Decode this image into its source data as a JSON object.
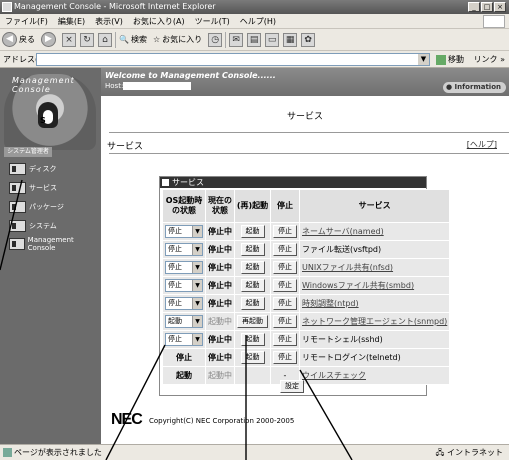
{
  "window": {
    "title": "Management Console - Microsoft Internet Explorer"
  },
  "menu": [
    "ファイル(F)",
    "編集(E)",
    "表示(V)",
    "お気に入り(A)",
    "ツール(T)",
    "ヘルプ(H)"
  ],
  "toolbar": {
    "back": "戻る",
    "search": "検索",
    "favorites": "お気に入り"
  },
  "address": {
    "label": "アドレス(D)",
    "value": "",
    "go": "移動",
    "links": "リンク »"
  },
  "sidebar": {
    "logo_text": "Management Console",
    "logo_letter": "S",
    "section_label": "システム管理者",
    "items": [
      {
        "label": "ディスク"
      },
      {
        "label": "サービス"
      },
      {
        "label": "パッケージ"
      },
      {
        "label": "システム"
      },
      {
        "label": "Management Console"
      }
    ]
  },
  "banner": {
    "welcome": "Welcome to Management Console......",
    "host_label": "Host:",
    "info": "Information"
  },
  "page": {
    "title": "サービス",
    "breadcrumb": "サービス",
    "help": "[ヘルプ]"
  },
  "services": {
    "header": "サービス",
    "columns": [
      "OS起動時の状態",
      "現在の状態",
      "(再)起動",
      "停止",
      "サービス"
    ],
    "rows": [
      {
        "boot": "停止",
        "state": "停止中",
        "start": "起動",
        "stop": "停止",
        "name": "ネームサーバ(named)",
        "link": true,
        "grey": false
      },
      {
        "boot": "停止",
        "state": "停止中",
        "start": "起動",
        "stop": "停止",
        "name": "ファイル転送(vsftpd)",
        "link": false,
        "grey": false
      },
      {
        "boot": "停止",
        "state": "停止中",
        "start": "起動",
        "stop": "停止",
        "name": "UNIXファイル共有(nfsd)",
        "link": true,
        "grey": false
      },
      {
        "boot": "停止",
        "state": "停止中",
        "start": "起動",
        "stop": "停止",
        "name": "Windowsファイル共有(smbd)",
        "link": true,
        "grey": false
      },
      {
        "boot": "停止",
        "state": "停止中",
        "start": "起動",
        "stop": "停止",
        "name": "時刻調整(ntpd)",
        "link": true,
        "grey": false
      },
      {
        "boot": "起動",
        "state": "起動中",
        "start": "再起動",
        "stop": "停止",
        "name": "ネットワーク管理エージェント(snmpd)",
        "link": true,
        "grey": true
      },
      {
        "boot": "停止",
        "state": "停止中",
        "start": "起動",
        "stop": "停止",
        "name": "リモートシェル(sshd)",
        "link": false,
        "grey": false
      },
      {
        "boot": "停止",
        "state": "停止中",
        "start": "起動",
        "stop": "停止",
        "name": "リモートログイン(telnetd)",
        "link": false,
        "grey": false,
        "fixed_boot": true
      },
      {
        "boot": "起動",
        "state": "起動中",
        "start": "",
        "stop": "-",
        "name": "ウイルスチェック",
        "link": true,
        "grey": true,
        "fixed_boot": true
      }
    ],
    "apply": "設定"
  },
  "footer": {
    "logo": "NEC",
    "copyright": "Copyright(C) NEC Corporation 2000-2005"
  },
  "status": {
    "text": "ページが表示されました",
    "zone": "イントラネット"
  }
}
